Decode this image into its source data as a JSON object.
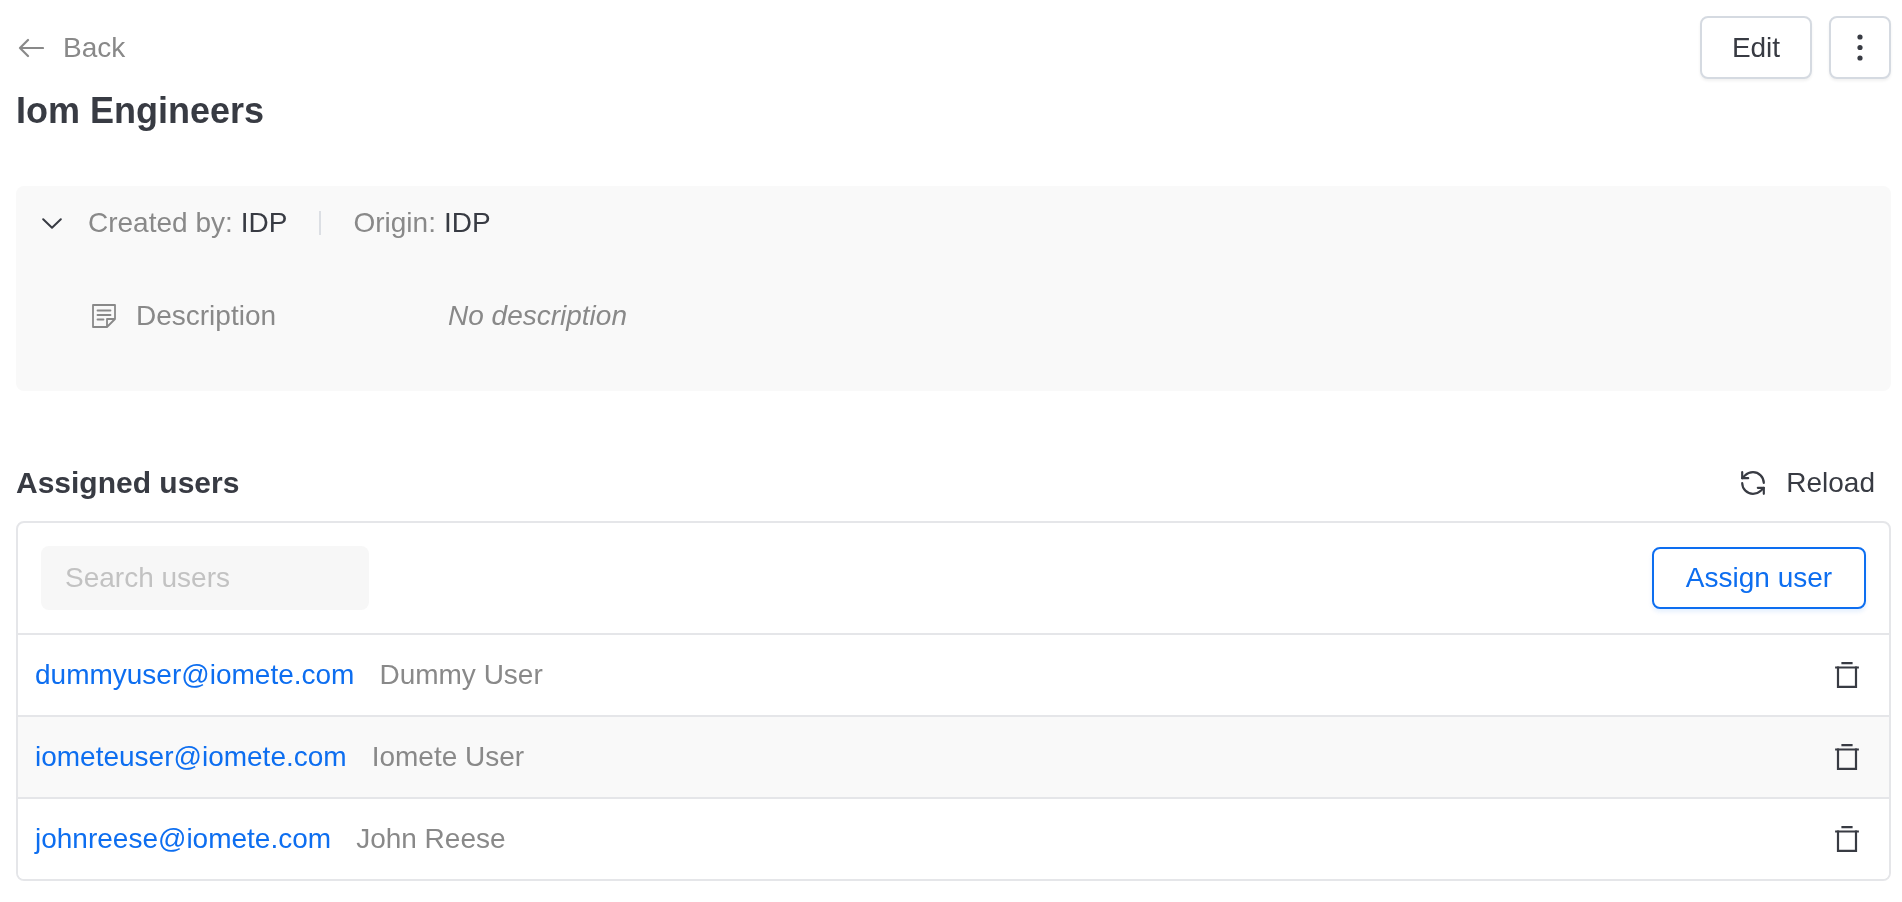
{
  "header": {
    "back_label": "Back",
    "title": "Iom Engineers",
    "edit_label": "Edit"
  },
  "info": {
    "expanded": true,
    "meta": [
      {
        "label": "Created by:",
        "value": "IDP"
      },
      {
        "label": "Origin:",
        "value": "IDP"
      }
    ],
    "details": [
      {
        "label": "Description",
        "value": "No description",
        "empty": true
      }
    ]
  },
  "assigned_users": {
    "title": "Assigned users",
    "reload_label": "Reload",
    "search": {
      "placeholder": "Search users"
    },
    "assign_label": "Assign user",
    "rows": [
      {
        "email": "dummyuser@iomete.com",
        "name": "Dummy User",
        "highlighted": false
      },
      {
        "email": "iometeuser@iomete.com",
        "name": "Iomete User",
        "highlighted": true
      },
      {
        "email": "johnreese@iomete.com",
        "name": "John Reese",
        "highlighted": false
      }
    ]
  }
}
